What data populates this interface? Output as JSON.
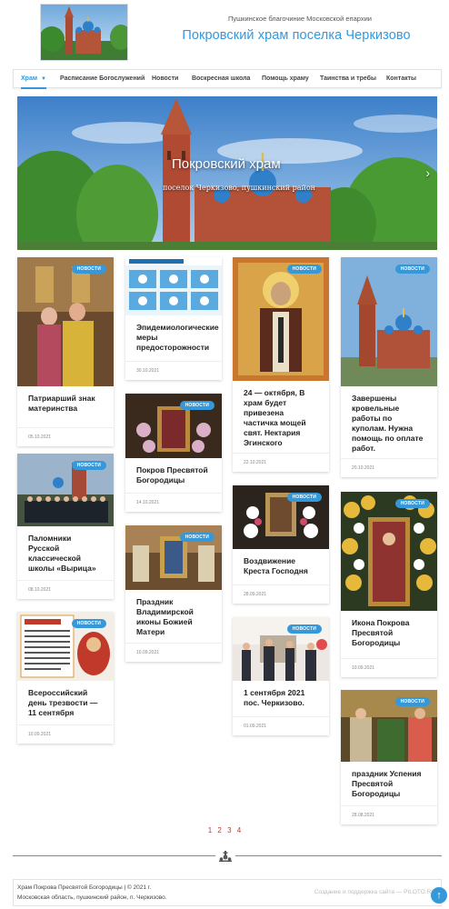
{
  "header": {
    "eparchy": "Пушкинское благочиние Московской епархии",
    "title": "Покровский храм поселка Черкизово"
  },
  "nav": {
    "items": [
      {
        "label": "Храм"
      },
      {
        "label": "Расписание Богослужений"
      },
      {
        "label": "Новости"
      },
      {
        "label": "Воскресная школа"
      },
      {
        "label": "Помощь храму"
      },
      {
        "label": "Таинства и требы"
      },
      {
        "label": "Контакты"
      }
    ]
  },
  "slider": {
    "title": "Покровский храм",
    "subtitle": "поселок Черкизово, пушкинский район",
    "next_icon": "chevron-right-icon"
  },
  "badge_label": "НОВОСТИ",
  "cards": [
    {
      "title": "Патриарший знак материнства",
      "date": "05.10.2021"
    },
    {
      "title": "Всероссийский день трезвости — 11 сентября",
      "date": "10.09.2021"
    },
    {
      "title": "Паломники Русской классической школы «Вырица»",
      "date": "08.10.2021"
    },
    {
      "title": "Эпидемиологические меры предосторожности",
      "date": "30.10.2021"
    },
    {
      "title": "Покров Пресвятой Богородицы",
      "date": "14.10.2021"
    },
    {
      "title": "Праздник Владимирской иконы Божией Матери",
      "date": "10.09.2021"
    },
    {
      "title": "24 — октября, В храм будет привезена частичка мощей свят. Нектария Эгинского",
      "date": "22.10.2021"
    },
    {
      "title": "Воздвижение Креста Господня",
      "date": "28.09.2021"
    },
    {
      "title": "1 сентября 2021 пос. Черкизово.",
      "date": "01.09.2021"
    },
    {
      "title": "Завершены кровельные работы по куполам. Нужна помощь по оплате работ.",
      "date": "20.10.2021"
    },
    {
      "title": "Икона Покрова Пресвятой Богородицы",
      "date": "10.09.2021"
    },
    {
      "title": "праздник Успения Пресвятой Богородицы",
      "date": "28.08.2021"
    }
  ],
  "pagination": [
    "1",
    "2",
    "3",
    "4"
  ],
  "footer": {
    "line1": "Храм Покрова Пресвятой Богородицы | © 2021 г.",
    "line2": "Московская область, пушкинский район, п. Черкизово.",
    "credit": "Создание и поддержка сайта — PILOTO.RU"
  },
  "to_top_icon": "arrow-up-icon",
  "colors": {
    "accent": "#3498db",
    "pagination": "#c0392b"
  }
}
